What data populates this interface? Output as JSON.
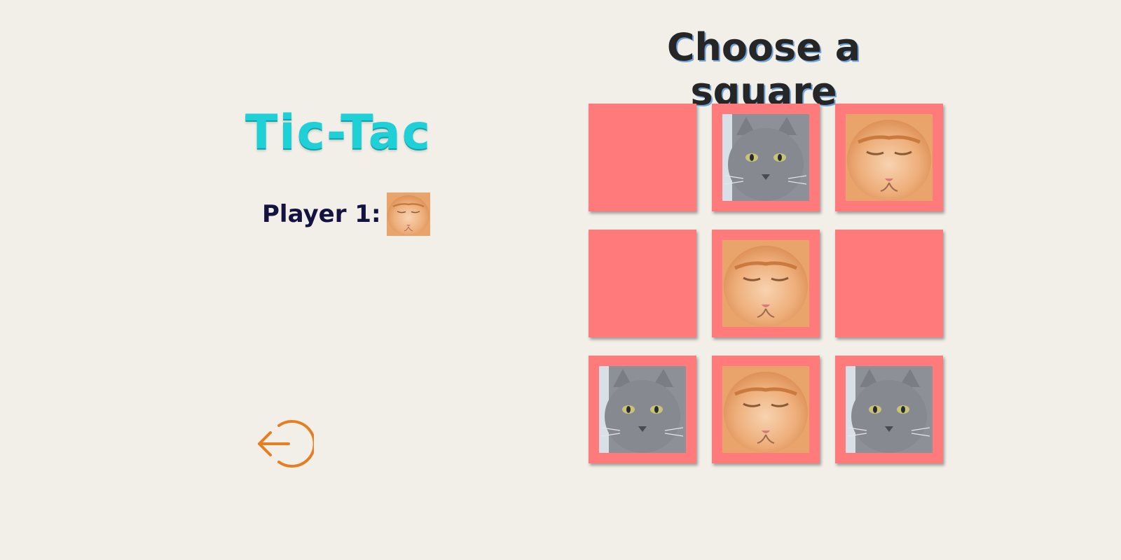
{
  "app": {
    "logo_text": "Tic-Tac",
    "player_label": "Player 1:",
    "current_player_icon": "ginger-cat",
    "heading": "Choose a square"
  },
  "board": {
    "cells": [
      {
        "index": 0,
        "value": "empty"
      },
      {
        "index": 1,
        "value": "gray-cat"
      },
      {
        "index": 2,
        "value": "ginger-cat"
      },
      {
        "index": 3,
        "value": "empty"
      },
      {
        "index": 4,
        "value": "ginger-cat"
      },
      {
        "index": 5,
        "value": "empty"
      },
      {
        "index": 6,
        "value": "gray-cat"
      },
      {
        "index": 7,
        "value": "ginger-cat"
      },
      {
        "index": 8,
        "value": "gray-cat"
      }
    ]
  },
  "controls": {
    "back_icon": "exit-arrow-icon"
  },
  "colors": {
    "background": "#f2efe9",
    "cell": "#ff7b7b",
    "logo": "#1fd0d6",
    "back_icon": "#e67e22",
    "player_text": "#14123f"
  }
}
